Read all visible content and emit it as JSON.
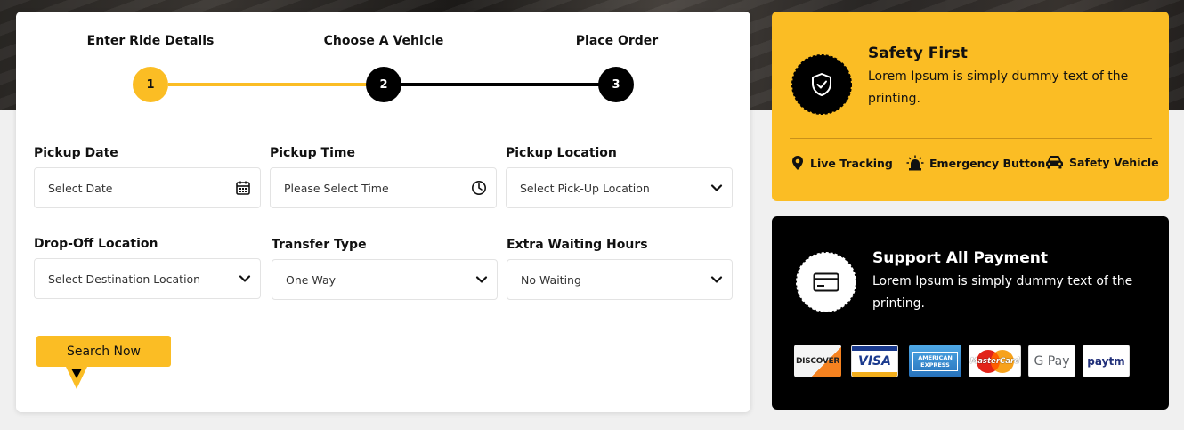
{
  "steps": [
    {
      "label": "Enter Ride Details",
      "number": "1",
      "state": "active"
    },
    {
      "label": "Choose A Vehicle",
      "number": "2",
      "state": "upcoming"
    },
    {
      "label": "Place Order",
      "number": "3",
      "state": "upcoming"
    }
  ],
  "form": {
    "pickup_date": {
      "label": "Pickup Date",
      "placeholder": "Select Date",
      "icon": "calendar-icon"
    },
    "pickup_time": {
      "label": "Pickup Time",
      "placeholder": "Please Select Time",
      "icon": "clock-icon"
    },
    "pickup_location": {
      "label": "Pickup Location",
      "value": "Select Pick-Up Location"
    },
    "dropoff_location": {
      "label": "Drop-Off Location",
      "value": "Select Destination Location"
    },
    "transfer_type": {
      "label": "Transfer Type",
      "value": "One Way"
    },
    "extra_waiting": {
      "label": "Extra Waiting Hours",
      "value": "No Waiting"
    },
    "search_button": "Search Now"
  },
  "safety": {
    "title": "Safety First",
    "description": "Lorem Ipsum is simply dummy text of the printing.",
    "icon": "shield-check-icon",
    "features": [
      {
        "label": "Live Tracking",
        "icon": "map-pin-icon"
      },
      {
        "label": "Emergency Button",
        "icon": "siren-icon"
      },
      {
        "label": "Safety Vehicle",
        "icon": "car-icon"
      }
    ]
  },
  "payment": {
    "title": "Support All Payment",
    "description": "Lorem Ipsum is simply dummy text of the printing.",
    "icon": "credit-card-icon",
    "methods": [
      {
        "name": "DISCOVER"
      },
      {
        "name": "VISA"
      },
      {
        "name": "AMERICAN EXPRESS"
      },
      {
        "name": "MasterCard"
      },
      {
        "name": "G Pay"
      },
      {
        "name": "paytm"
      }
    ]
  },
  "colors": {
    "accent": "#fbbd24",
    "dark": "#000000",
    "page_bg": "#f0f0f0"
  }
}
